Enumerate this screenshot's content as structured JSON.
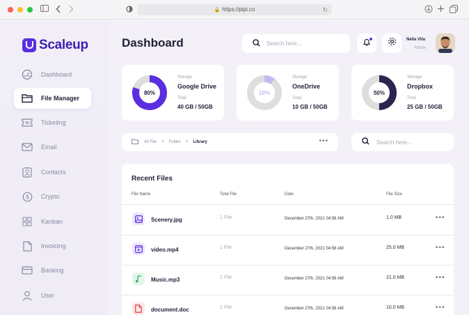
{
  "browser": {
    "url": "https://pipi.co"
  },
  "app": {
    "brand": "Scaleup",
    "brand_color": "#5b2ee0"
  },
  "sidebar": {
    "items": [
      {
        "label": "Dashboard",
        "icon": "dashboard-icon",
        "active": false
      },
      {
        "label": "File Manager",
        "icon": "folder-icon",
        "active": true
      },
      {
        "label": "Ticketing",
        "icon": "ticket-icon",
        "active": false
      },
      {
        "label": "Email",
        "icon": "mail-icon",
        "active": false
      },
      {
        "label": "Contacts",
        "icon": "contacts-icon",
        "active": false
      },
      {
        "label": "Crypto",
        "icon": "coin-icon",
        "active": false
      },
      {
        "label": "Kanban",
        "icon": "kanban-icon",
        "active": false
      },
      {
        "label": "Invoicing",
        "icon": "invoice-icon",
        "active": false
      },
      {
        "label": "Banking",
        "icon": "card-icon",
        "active": false
      },
      {
        "label": "User",
        "icon": "user-icon",
        "active": false
      }
    ]
  },
  "header": {
    "title": "Dashboard",
    "search_placeholder": "Search here...",
    "user_name": "Nella Vita",
    "user_role": "Admin"
  },
  "storage": [
    {
      "label": "Storage",
      "name": "Google Drive",
      "total_label": "Total",
      "size": "40 GB / 50GB",
      "percent": 80,
      "percent_label": "80%",
      "color": "#5b2ee0",
      "track": "#dedede"
    },
    {
      "label": "Storage",
      "name": "OneDrive",
      "total_label": "Total",
      "size": "10 GB / 50GB",
      "percent": 10,
      "percent_label": "10%",
      "color": "#c7b8f5",
      "track": "#dedede"
    },
    {
      "label": "Storage",
      "name": "Dropbox",
      "total_label": "Total",
      "size": "25 GB / 50GB",
      "percent": 50,
      "percent_label": "50%",
      "color": "#2b2550",
      "track": "#dedede"
    }
  ],
  "breadcrumb": {
    "items": [
      "All File",
      "Folder",
      "Library"
    ],
    "separator": "/"
  },
  "file_search_placeholder": "Search here...",
  "files": {
    "title": "Recent Files",
    "columns": [
      "File Name",
      "Total File",
      "Date",
      "File Size"
    ],
    "rows": [
      {
        "name": "Scenery.jpg",
        "total": "1 File",
        "date": "December 27th, 2021 04:56 AM",
        "size": "1.0 MB",
        "icon": "image-icon",
        "icon_bg": "#ece6fd",
        "icon_color": "#5b2ee0"
      },
      {
        "name": "video.mp4",
        "total": "1 File",
        "date": "December 27th, 2021 04:56 AM",
        "size": "25.0 MB",
        "icon": "video-icon",
        "icon_bg": "#ece6fd",
        "icon_color": "#5b2ee0"
      },
      {
        "name": "Music.mp3",
        "total": "1 File",
        "date": "December 27th, 2021 04:56 AM",
        "size": "21.0 MB",
        "icon": "music-icon",
        "icon_bg": "#e3f6ea",
        "icon_color": "#2fb36b"
      },
      {
        "name": "document.doc",
        "total": "1 File",
        "date": "December 27th, 2021 04:56 AM",
        "size": "10.0 MB",
        "icon": "document-icon",
        "icon_bg": "#fde6e8",
        "icon_color": "#e5484d"
      }
    ]
  }
}
